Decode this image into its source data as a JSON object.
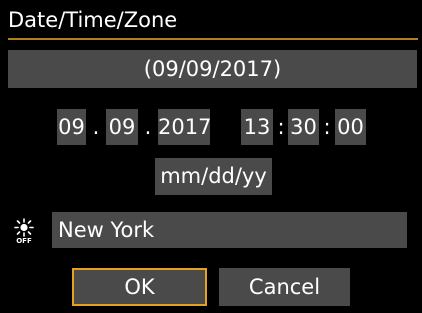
{
  "screen": {
    "title": "Date/Time/Zone",
    "date_display": "(09/09/2017)",
    "datetime": {
      "month": "09",
      "day": "09",
      "year": "2017",
      "date_separator": ".",
      "hour": "13",
      "minute": "30",
      "second": "00",
      "time_separator": ":"
    },
    "date_format": "mm/dd/yy",
    "daylight_saving_icon": "sun-off-icon",
    "time_zone": "New York",
    "buttons": {
      "ok": "OK",
      "cancel": "Cancel"
    }
  },
  "colors": {
    "background": "#000000",
    "field": "#4a4a4a",
    "accent": "#e8a020",
    "title_rule": "#b07e1f"
  }
}
